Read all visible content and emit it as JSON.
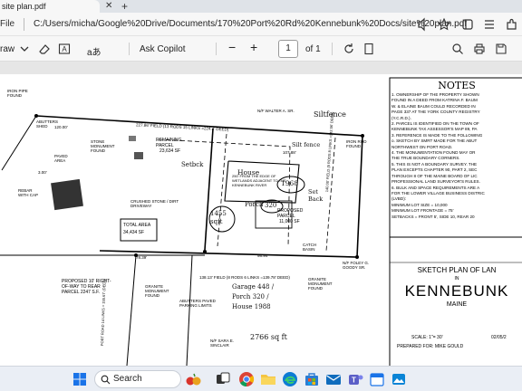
{
  "browser": {
    "tab_title": "site plan.pdf",
    "file_label": "File",
    "url": "C:/Users/micha/Google%20Drive/Documents/170%20Port%20Rd%20Kennebunk%20Docs/site%20plan.pdf"
  },
  "toolbar": {
    "draw_label": "raw",
    "read_aloud_label": "aあ",
    "copilot_label": "Ask Copilot",
    "page_current": "1",
    "page_total": "of 1"
  },
  "plan": {
    "notes_title": "NOTES",
    "notes": [
      "1. OWNERSHIP OF THE PROPERTY SHOWN",
      "FOUND IN A DEED FROM KATRINA F. BAUM",
      "W. & ELAINE BAUM COULD RECORDED IN",
      "PAGE 337 AT THE YORK COUNTY REGISTRY",
      "(Y.C.R.D.).",
      "2. PARCEL IS IDENTIFIED ON THE TOWN OF",
      "KENNEBUNK TAX ASSESSOR'S MAP 89, PA",
      "3. REFERENCE IS MADE TO THE FOLLOWING",
      "o. SKETCH BY SMRT MADE FOR THE ABUT",
      "NORTHWEST ON PORT ROAD.",
      "4. THE MONUMENTATION FOUND MAY OR",
      "THE TRUE BOUNDARY CORNERS.",
      "5. THIS IS NOT A BOUNDARY SURVEY. THE",
      "PLAN EXCEPTS CHAPTER 90, PART 2, SEC",
      "THROUGH 8 OF THE MAINE BOARD OF LIC",
      "PROFESSIONAL LAND SURVEYOR'S RULES.",
      "6. BULK AND SPACE REQUIREMENTS ARE A",
      "FOR THE LOWER VILLAGE BUSINESS DISTRIC",
      "(LVBD):",
      "MINIMUM LOT SIZE = 10,000",
      "MINIMUM LOT FRONTAGE = 75'",
      "SETBACKS = FRONT 5', SIDE 10, REAR 20"
    ],
    "sketch_title": "SKETCH PLAN OF LAN",
    "sketch_in": "IN",
    "town": "KENNEBUNK",
    "state": "MAINE",
    "scale": "SCALE: 1\"= 30'",
    "date": "02/05/2",
    "prepared": "PREPARED FOR:   MIKE GOULD",
    "labels": {
      "iron_pipe": "IRON PIPE FOUND",
      "abutters_shed": "ABUTTERS SHED",
      "paved_area": "PAVED AREA",
      "rebar_cap": "REBAR WITH CAP",
      "stone_monument": "STONE MONUMENT FOUND",
      "remaining_parcel": "REMAINING PARCEL",
      "remaining_area": "23,634 SF",
      "crushed_stone": "CRUSHED STONE / DIRT DRIVEWAY",
      "total_area_label": "TOTAL AREA",
      "total_area": "34,434 SF",
      "proposed_parcel": "PROPOSED PARCEL",
      "proposed_area": "11,000 SF",
      "wetland_note": "250' FROM THE EDGE OF WETLANDS ADJACENT TO THE KENNEBUNK RIVER",
      "top_field": "227.86' FIELD (13 RODS 15 LINKS =224.4' DEED)",
      "top_dist2": "107.88'",
      "top_dist3": "120.00'",
      "walter": "N/F WALTER A. SR.",
      "iron_rod": "IRON ROD FOUND",
      "catch_basin": "CATCH BASIN",
      "rod_side": "140.00' FIELD (8 RODS 8 LINKS =142.56' DEED)",
      "bottom_field": "138.13' FIELD (8 RODS 6 LINKS =139.78' DEED)",
      "dist_7839": "78.39'",
      "dist_9894": "98.94'",
      "granite_left": "GRANITE MONUMENT FOUND",
      "abutters_paved": "ABUTTERS PAVED PARKING LIMITS",
      "granite_right": "GRANITE MONUMENT FOUND",
      "proposed_row": "PROPOSED 10' RIGHT-OF-WAY TO REAR PARCEL 2247 S.F.",
      "left_rods": "PORT ROAD 14 LINKS = 155.67' (DEED)",
      "sinclair": "N/F SARA E. SINCLAIR",
      "foley": "N/F FOLEY G. GOODY SR.",
      "dist_300": "3.00'"
    },
    "handwritten": {
      "silt_fence_top": "Siltfence",
      "silt_fence_mid": "Silt fence",
      "setback_left": "Setbck",
      "setback_right": "Set Back",
      "year_1968": "1968",
      "house": "House",
      "porch": "Porch",
      "area_320": "320",
      "area_1455": "1455 sqft",
      "garage_stack": "Garage 448 / Porch 320 / House 1988",
      "total_sqft": "2766 sq ft"
    }
  },
  "taskbar": {
    "search_label": "Search"
  },
  "colors": {
    "accent": "#1a73e8",
    "taskbar": "#eaeef5"
  }
}
